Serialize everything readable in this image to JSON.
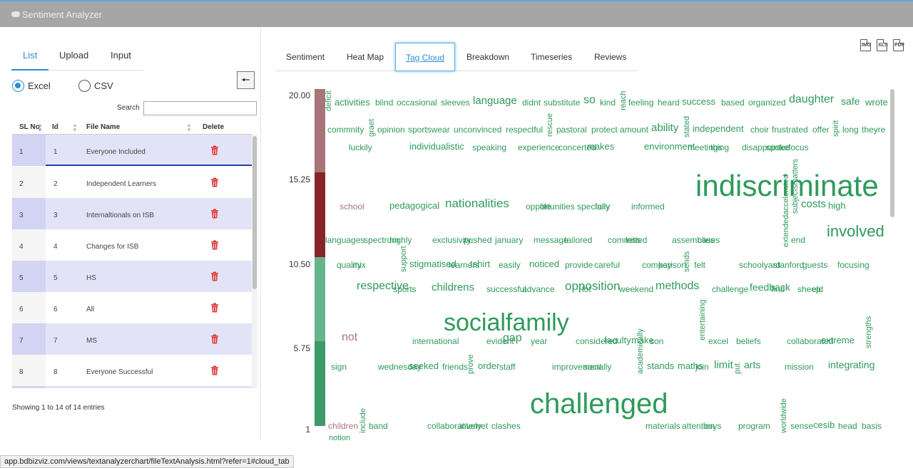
{
  "app": {
    "title": "Sentiment Analyzer"
  },
  "left": {
    "tabs": [
      {
        "label": "List",
        "active": true
      },
      {
        "label": "Upload",
        "active": false
      },
      {
        "label": "Input",
        "active": false
      }
    ],
    "file_types": [
      {
        "label": "Excel",
        "selected": true
      },
      {
        "label": "CSV",
        "selected": false
      }
    ],
    "back_glyph": "🠔",
    "search_label": "Search",
    "search_value": "",
    "columns": [
      "SL No",
      "Id",
      "File Name",
      "Delete"
    ],
    "rows": [
      {
        "sl": "1",
        "id": "1",
        "name": "Everyone Included"
      },
      {
        "sl": "2",
        "id": "2",
        "name": "Independent Learners"
      },
      {
        "sl": "3",
        "id": "3",
        "name": "Internaltionals on ISB"
      },
      {
        "sl": "4",
        "id": "4",
        "name": "Changes for ISB"
      },
      {
        "sl": "5",
        "id": "5",
        "name": "HS"
      },
      {
        "sl": "6",
        "id": "6",
        "name": "All"
      },
      {
        "sl": "7",
        "id": "7",
        "name": "MS"
      },
      {
        "sl": "8",
        "id": "8",
        "name": "Everyone Successful"
      }
    ],
    "delete_icon": "trash-icon",
    "delete_color": "#e03a3a",
    "entries_info": "Showing 1 to 14 of 14 entries"
  },
  "right": {
    "tabs": [
      {
        "label": "Sentiment",
        "active": false
      },
      {
        "label": "Heat Map",
        "active": false
      },
      {
        "label": "Tag Cloud",
        "active": true
      },
      {
        "label": "Breakdown",
        "active": false
      },
      {
        "label": "Timeseries",
        "active": false
      },
      {
        "label": "Reviews",
        "active": false
      }
    ],
    "export_icons": [
      "image-export-icon",
      "excel-export-icon",
      "pdf-export-icon"
    ],
    "export_labels": [
      "IMG",
      "XLS",
      "PDF"
    ],
    "accent_color": "#2d8fd5",
    "tag_cloud": {
      "scale_labels": [
        "20.00",
        "15.25",
        "10.50",
        "5.75",
        "1"
      ],
      "scale_colors": [
        "#a8757a",
        "#862527",
        "#66b38d",
        "#3d9a6a"
      ],
      "positive_color": "#2e9a5a",
      "negative_color": "#a8757a",
      "words": [
        {
          "text": "deficit",
          "color": "#2e9a5a"
        },
        {
          "text": "activities",
          "color": "#2e9a5a"
        },
        {
          "text": "blind",
          "color": "#2e9a5a"
        },
        {
          "text": "occasional",
          "color": "#2e9a5a"
        },
        {
          "text": "sleeves",
          "color": "#2e9a5a"
        },
        {
          "text": "language",
          "color": "#2e9a5a"
        },
        {
          "text": "didnt",
          "color": "#2e9a5a"
        },
        {
          "text": "substitute",
          "color": "#2e9a5a"
        },
        {
          "text": "so",
          "color": "#2e9a5a"
        },
        {
          "text": "kind",
          "color": "#2e9a5a"
        },
        {
          "text": "reach",
          "color": "#2e9a5a"
        },
        {
          "text": "feeling",
          "color": "#2e9a5a"
        },
        {
          "text": "heard",
          "color": "#2e9a5a"
        },
        {
          "text": "success",
          "color": "#2e9a5a"
        },
        {
          "text": "based",
          "color": "#2e9a5a"
        },
        {
          "text": "organized",
          "color": "#2e9a5a"
        },
        {
          "text": "daughter",
          "color": "#2e9a5a"
        },
        {
          "text": "safe",
          "color": "#2e9a5a"
        },
        {
          "text": "wrote",
          "color": "#2e9a5a"
        },
        {
          "text": "commnity",
          "color": "#2e9a5a"
        },
        {
          "text": "graet",
          "color": "#2e9a5a"
        },
        {
          "text": "opinion",
          "color": "#2e9a5a"
        },
        {
          "text": "sportswear",
          "color": "#2e9a5a"
        },
        {
          "text": "unconvinced",
          "color": "#2e9a5a"
        },
        {
          "text": "respectful",
          "color": "#2e9a5a"
        },
        {
          "text": "rescue",
          "color": "#2e9a5a"
        },
        {
          "text": "pastoral",
          "color": "#2e9a5a"
        },
        {
          "text": "protect",
          "color": "#2e9a5a"
        },
        {
          "text": "amount",
          "color": "#2e9a5a"
        },
        {
          "text": "ability",
          "color": "#2e9a5a"
        },
        {
          "text": "stated",
          "color": "#2e9a5a"
        },
        {
          "text": "independent",
          "color": "#2e9a5a"
        },
        {
          "text": "choir",
          "color": "#2e9a5a"
        },
        {
          "text": "frustrated",
          "color": "#2e9a5a"
        },
        {
          "text": "offer",
          "color": "#2e9a5a"
        },
        {
          "text": "spirit",
          "color": "#2e9a5a"
        },
        {
          "text": "long",
          "color": "#2e9a5a"
        },
        {
          "text": "theyre",
          "color": "#2e9a5a"
        },
        {
          "text": "luckily",
          "color": "#2e9a5a"
        },
        {
          "text": "individualistic",
          "color": "#2e9a5a"
        },
        {
          "text": "speaking",
          "color": "#2e9a5a"
        },
        {
          "text": "experience",
          "color": "#2e9a5a"
        },
        {
          "text": "concerted",
          "color": "#2e9a5a"
        },
        {
          "text": "makes",
          "color": "#2e9a5a"
        },
        {
          "text": "environment",
          "color": "#2e9a5a"
        },
        {
          "text": "meetings",
          "color": "#2e9a5a"
        },
        {
          "text": "thing",
          "color": "#2e9a5a"
        },
        {
          "text": "disappointed",
          "color": "#2e9a5a"
        },
        {
          "text": "spoke",
          "color": "#2e9a5a"
        },
        {
          "text": "focus",
          "color": "#2e9a5a"
        },
        {
          "text": "indiscriminate",
          "color": "#2e9a5a"
        },
        {
          "text": "school",
          "color": "#a8757a"
        },
        {
          "text": "pedagogical",
          "color": "#2e9a5a"
        },
        {
          "text": "nationalities",
          "color": "#2e9a5a"
        },
        {
          "text": "opportunities",
          "color": "#2e9a5a"
        },
        {
          "text": "life",
          "color": "#2e9a5a"
        },
        {
          "text": "specially",
          "color": "#2e9a5a"
        },
        {
          "text": "fully",
          "color": "#2e9a5a"
        },
        {
          "text": "informed",
          "color": "#2e9a5a"
        },
        {
          "text": "subjectsmatters",
          "color": "#2e9a5a"
        },
        {
          "text": "costs",
          "color": "#2e9a5a"
        },
        {
          "text": "high",
          "color": "#2e9a5a"
        },
        {
          "text": "languages",
          "color": "#2e9a5a"
        },
        {
          "text": "spectrum",
          "color": "#2e9a5a"
        },
        {
          "text": "highly",
          "color": "#2e9a5a"
        },
        {
          "text": "exclusivity",
          "color": "#2e9a5a"
        },
        {
          "text": "pushed",
          "color": "#2e9a5a"
        },
        {
          "text": "january",
          "color": "#2e9a5a"
        },
        {
          "text": "message",
          "color": "#2e9a5a"
        },
        {
          "text": "tailored",
          "color": "#2e9a5a"
        },
        {
          "text": "committed",
          "color": "#2e9a5a"
        },
        {
          "text": "less",
          "color": "#2e9a5a"
        },
        {
          "text": "assemblies",
          "color": "#2e9a5a"
        },
        {
          "text": "cases",
          "color": "#2e9a5a"
        },
        {
          "text": "extendedaccelerated",
          "color": "#2e9a5a"
        },
        {
          "text": "end",
          "color": "#2e9a5a"
        },
        {
          "text": "involved",
          "color": "#2e9a5a"
        },
        {
          "text": "support",
          "color": "#2e9a5a"
        },
        {
          "text": "quality",
          "color": "#2e9a5a"
        },
        {
          "text": "mix",
          "color": "#2e9a5a"
        },
        {
          "text": "stigmatised",
          "color": "#2e9a5a"
        },
        {
          "text": "learners",
          "color": "#2e9a5a"
        },
        {
          "text": "tshirt",
          "color": "#2e9a5a"
        },
        {
          "text": "easily",
          "color": "#2e9a5a"
        },
        {
          "text": "noticed",
          "color": "#2e9a5a"
        },
        {
          "text": "provide",
          "color": "#2e9a5a"
        },
        {
          "text": "careful",
          "color": "#2e9a5a"
        },
        {
          "text": "comparison",
          "color": "#2e9a5a"
        },
        {
          "text": "key",
          "color": "#2e9a5a"
        },
        {
          "text": "sends",
          "color": "#2e9a5a"
        },
        {
          "text": "felt",
          "color": "#2e9a5a"
        },
        {
          "text": "schoolyard",
          "color": "#2e9a5a"
        },
        {
          "text": "stanford",
          "color": "#2e9a5a"
        },
        {
          "text": "guests",
          "color": "#2e9a5a"
        },
        {
          "text": "focusing",
          "color": "#2e9a5a"
        },
        {
          "text": "respective",
          "color": "#2e9a5a"
        },
        {
          "text": "sports",
          "color": "#2e9a5a"
        },
        {
          "text": "childrens",
          "color": "#2e9a5a"
        },
        {
          "text": "successful",
          "color": "#2e9a5a"
        },
        {
          "text": "advance",
          "color": "#2e9a5a"
        },
        {
          "text": "opposition",
          "color": "#2e9a5a"
        },
        {
          "text": "lot",
          "color": "#2e9a5a"
        },
        {
          "text": "weekend",
          "color": "#2e9a5a"
        },
        {
          "text": "methods",
          "color": "#2e9a5a"
        },
        {
          "text": "challenge",
          "color": "#2e9a5a"
        },
        {
          "text": "feedback",
          "color": "#2e9a5a"
        },
        {
          "text": "find",
          "color": "#2e9a5a"
        },
        {
          "text": "sheep",
          "color": "#2e9a5a"
        },
        {
          "text": "eld",
          "color": "#2e9a5a"
        },
        {
          "text": "socialfamily",
          "color": "#2e9a5a"
        },
        {
          "text": "not",
          "color": "#a8757a"
        },
        {
          "text": "international",
          "color": "#2e9a5a"
        },
        {
          "text": "evident",
          "color": "#2e9a5a"
        },
        {
          "text": "gap",
          "color": "#2e9a5a"
        },
        {
          "text": "year",
          "color": "#2e9a5a"
        },
        {
          "text": "considered",
          "color": "#2e9a5a"
        },
        {
          "text": "faculty",
          "color": "#2e9a5a"
        },
        {
          "text": "make",
          "color": "#2e9a5a"
        },
        {
          "text": "son",
          "color": "#2e9a5a"
        },
        {
          "text": "entertaining",
          "color": "#2e9a5a"
        },
        {
          "text": "excel",
          "color": "#2e9a5a"
        },
        {
          "text": "beliefs",
          "color": "#2e9a5a"
        },
        {
          "text": "collaborated",
          "color": "#2e9a5a"
        },
        {
          "text": "extreme",
          "color": "#2e9a5a"
        },
        {
          "text": "strengths",
          "color": "#2e9a5a"
        },
        {
          "text": "sign",
          "color": "#2e9a5a"
        },
        {
          "text": "wednesday",
          "color": "#2e9a5a"
        },
        {
          "text": "seeked",
          "color": "#2e9a5a"
        },
        {
          "text": "friends",
          "color": "#2e9a5a"
        },
        {
          "text": "prove",
          "color": "#2e9a5a"
        },
        {
          "text": "order",
          "color": "#2e9a5a"
        },
        {
          "text": "staff",
          "color": "#2e9a5a"
        },
        {
          "text": "improvement",
          "color": "#2e9a5a"
        },
        {
          "text": "socially",
          "color": "#2e9a5a"
        },
        {
          "text": "academically",
          "color": "#2e9a5a"
        },
        {
          "text": "stands",
          "color": "#2e9a5a"
        },
        {
          "text": "maths",
          "color": "#2e9a5a"
        },
        {
          "text": "join",
          "color": "#2e9a5a"
        },
        {
          "text": "limit",
          "color": "#2e9a5a"
        },
        {
          "text": "put",
          "color": "#2e9a5a"
        },
        {
          "text": "arts",
          "color": "#2e9a5a"
        },
        {
          "text": "mission",
          "color": "#2e9a5a"
        },
        {
          "text": "integrating",
          "color": "#2e9a5a"
        },
        {
          "text": "challenged",
          "color": "#2e9a5a"
        },
        {
          "text": "children",
          "color": "#a8757a"
        },
        {
          "text": "include",
          "color": "#2e9a5a"
        },
        {
          "text": "band",
          "color": "#2e9a5a"
        },
        {
          "text": "collaboratively",
          "color": "#2e9a5a"
        },
        {
          "text": "internet",
          "color": "#2e9a5a"
        },
        {
          "text": "clashes",
          "color": "#2e9a5a"
        },
        {
          "text": "materials",
          "color": "#2e9a5a"
        },
        {
          "text": "attention",
          "color": "#2e9a5a"
        },
        {
          "text": "boys",
          "color": "#2e9a5a"
        },
        {
          "text": "program",
          "color": "#2e9a5a"
        },
        {
          "text": "worldwide",
          "color": "#2e9a5a"
        },
        {
          "text": "sense",
          "color": "#2e9a5a"
        },
        {
          "text": "cesib",
          "color": "#2e9a5a"
        },
        {
          "text": "head",
          "color": "#2e9a5a"
        },
        {
          "text": "basis",
          "color": "#2e9a5a"
        },
        {
          "text": "notion",
          "color": "#2e9a5a"
        },
        {
          "text": "s",
          "color": "#2e9a5a"
        }
      ]
    }
  },
  "status_url": "app.bdbizviz.com/views/textanalyzerchart/fileTextAnalysis.html?refer=1#cloud_tab"
}
